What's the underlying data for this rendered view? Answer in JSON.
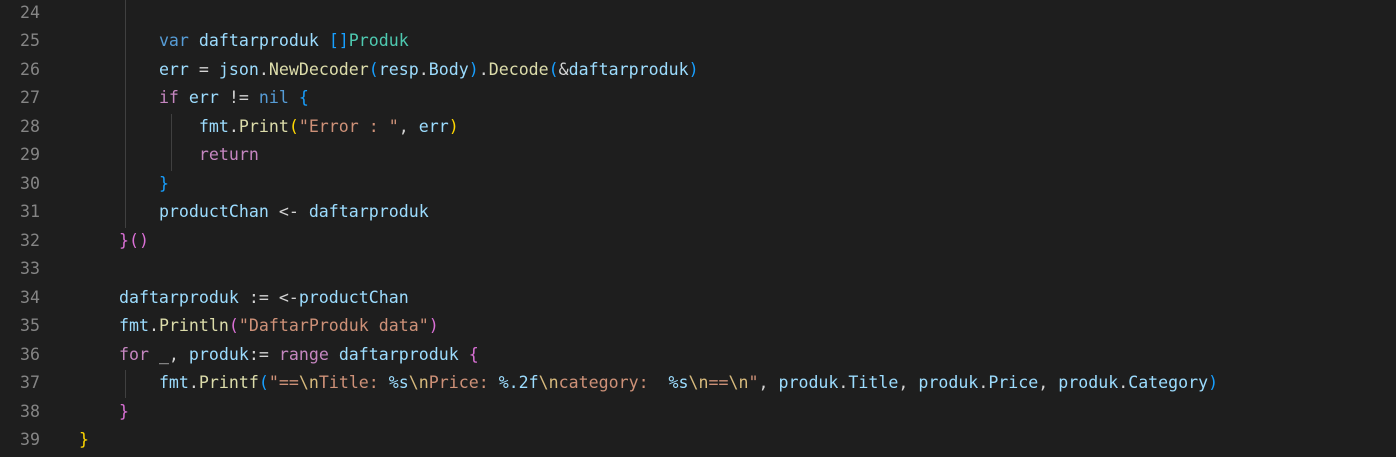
{
  "lines": [
    {
      "n": "24",
      "tokens": [
        {
          "t": "",
          "c": "op"
        }
      ]
    },
    {
      "n": "25",
      "tokens": [
        {
          "t": "        ",
          "c": "op"
        },
        {
          "t": "var",
          "c": "kw"
        },
        {
          "t": " ",
          "c": "op"
        },
        {
          "t": "daftarproduk",
          "c": "var"
        },
        {
          "t": " ",
          "c": "op"
        },
        {
          "t": "[]",
          "c": "b3"
        },
        {
          "t": "Produk",
          "c": "typ"
        }
      ]
    },
    {
      "n": "26",
      "tokens": [
        {
          "t": "        ",
          "c": "op"
        },
        {
          "t": "err",
          "c": "var"
        },
        {
          "t": " = ",
          "c": "op"
        },
        {
          "t": "json",
          "c": "var"
        },
        {
          "t": ".",
          "c": "op"
        },
        {
          "t": "NewDecoder",
          "c": "fn"
        },
        {
          "t": "(",
          "c": "b3"
        },
        {
          "t": "resp",
          "c": "var"
        },
        {
          "t": ".",
          "c": "op"
        },
        {
          "t": "Body",
          "c": "var"
        },
        {
          "t": ")",
          "c": "b3"
        },
        {
          "t": ".",
          "c": "op"
        },
        {
          "t": "Decode",
          "c": "fn"
        },
        {
          "t": "(",
          "c": "b3"
        },
        {
          "t": "&",
          "c": "op"
        },
        {
          "t": "daftarproduk",
          "c": "var"
        },
        {
          "t": ")",
          "c": "b3"
        }
      ]
    },
    {
      "n": "27",
      "tokens": [
        {
          "t": "        ",
          "c": "op"
        },
        {
          "t": "if",
          "c": "ctl"
        },
        {
          "t": " ",
          "c": "op"
        },
        {
          "t": "err",
          "c": "var"
        },
        {
          "t": " != ",
          "c": "op"
        },
        {
          "t": "nil",
          "c": "kw"
        },
        {
          "t": " ",
          "c": "op"
        },
        {
          "t": "{",
          "c": "b3"
        }
      ]
    },
    {
      "n": "28",
      "tokens": [
        {
          "t": "            ",
          "c": "op"
        },
        {
          "t": "fmt",
          "c": "var"
        },
        {
          "t": ".",
          "c": "op"
        },
        {
          "t": "Print",
          "c": "fn"
        },
        {
          "t": "(",
          "c": "b1"
        },
        {
          "t": "\"Error : \"",
          "c": "str"
        },
        {
          "t": ", ",
          "c": "op"
        },
        {
          "t": "err",
          "c": "var"
        },
        {
          "t": ")",
          "c": "b1"
        }
      ]
    },
    {
      "n": "29",
      "tokens": [
        {
          "t": "            ",
          "c": "op"
        },
        {
          "t": "return",
          "c": "ctl"
        }
      ]
    },
    {
      "n": "30",
      "tokens": [
        {
          "t": "        ",
          "c": "op"
        },
        {
          "t": "}",
          "c": "b3"
        }
      ]
    },
    {
      "n": "31",
      "tokens": [
        {
          "t": "        ",
          "c": "op"
        },
        {
          "t": "productChan",
          "c": "var"
        },
        {
          "t": " <- ",
          "c": "op"
        },
        {
          "t": "daftarproduk",
          "c": "var"
        }
      ]
    },
    {
      "n": "32",
      "tokens": [
        {
          "t": "    ",
          "c": "op"
        },
        {
          "t": "}",
          "c": "b2"
        },
        {
          "t": "()",
          "c": "b2"
        }
      ]
    },
    {
      "n": "33",
      "tokens": [
        {
          "t": "",
          "c": "op"
        }
      ]
    },
    {
      "n": "34",
      "tokens": [
        {
          "t": "    ",
          "c": "op"
        },
        {
          "t": "daftarproduk",
          "c": "var"
        },
        {
          "t": " := <-",
          "c": "op"
        },
        {
          "t": "productChan",
          "c": "var"
        }
      ]
    },
    {
      "n": "35",
      "tokens": [
        {
          "t": "    ",
          "c": "op"
        },
        {
          "t": "fmt",
          "c": "var"
        },
        {
          "t": ".",
          "c": "op"
        },
        {
          "t": "Println",
          "c": "fn"
        },
        {
          "t": "(",
          "c": "b2"
        },
        {
          "t": "\"DaftarProduk data\"",
          "c": "str"
        },
        {
          "t": ")",
          "c": "b2"
        }
      ]
    },
    {
      "n": "36",
      "tokens": [
        {
          "t": "    ",
          "c": "op"
        },
        {
          "t": "for",
          "c": "ctl"
        },
        {
          "t": " _, ",
          "c": "op"
        },
        {
          "t": "produk",
          "c": "var"
        },
        {
          "t": ":= ",
          "c": "op"
        },
        {
          "t": "range",
          "c": "ctl"
        },
        {
          "t": " ",
          "c": "op"
        },
        {
          "t": "daftarproduk",
          "c": "var"
        },
        {
          "t": " ",
          "c": "op"
        },
        {
          "t": "{",
          "c": "b2"
        }
      ]
    },
    {
      "n": "37",
      "tokens": [
        {
          "t": "        ",
          "c": "op"
        },
        {
          "t": "fmt",
          "c": "var"
        },
        {
          "t": ".",
          "c": "op"
        },
        {
          "t": "Printf",
          "c": "fn"
        },
        {
          "t": "(",
          "c": "b3"
        },
        {
          "t": "\"==",
          "c": "str"
        },
        {
          "t": "\\n",
          "c": "esc"
        },
        {
          "t": "Title: ",
          "c": "str"
        },
        {
          "t": "%s",
          "c": "fmt"
        },
        {
          "t": "\\n",
          "c": "esc"
        },
        {
          "t": "Price: ",
          "c": "str"
        },
        {
          "t": "%.2f",
          "c": "fmt"
        },
        {
          "t": "\\n",
          "c": "esc"
        },
        {
          "t": "category:  ",
          "c": "str"
        },
        {
          "t": "%s",
          "c": "fmt"
        },
        {
          "t": "\\n",
          "c": "esc"
        },
        {
          "t": "==",
          "c": "str"
        },
        {
          "t": "\\n",
          "c": "esc"
        },
        {
          "t": "\"",
          "c": "str"
        },
        {
          "t": ", ",
          "c": "op"
        },
        {
          "t": "produk",
          "c": "var"
        },
        {
          "t": ".",
          "c": "op"
        },
        {
          "t": "Title",
          "c": "var"
        },
        {
          "t": ", ",
          "c": "op"
        },
        {
          "t": "produk",
          "c": "var"
        },
        {
          "t": ".",
          "c": "op"
        },
        {
          "t": "Price",
          "c": "var"
        },
        {
          "t": ", ",
          "c": "op"
        },
        {
          "t": "produk",
          "c": "var"
        },
        {
          "t": ".",
          "c": "op"
        },
        {
          "t": "Category",
          "c": "var"
        },
        {
          "t": ")",
          "c": "b3"
        }
      ]
    },
    {
      "n": "38",
      "tokens": [
        {
          "t": "    ",
          "c": "op"
        },
        {
          "t": "}",
          "c": "b2"
        }
      ]
    },
    {
      "n": "39",
      "tokens": [
        {
          "t": "}",
          "c": "b1"
        }
      ]
    }
  ],
  "theme": {
    "background": "#1e1e1e",
    "line_number": "#858585",
    "keyword": "#569cd6",
    "control": "#c586c0",
    "variable": "#9cdcfe",
    "function": "#dcdcaa",
    "string": "#ce9178",
    "escape": "#d7ba7d",
    "type": "#4ec9b0",
    "bracket_1": "#ffd700",
    "bracket_2": "#da70d6",
    "bracket_3": "#179fff"
  }
}
